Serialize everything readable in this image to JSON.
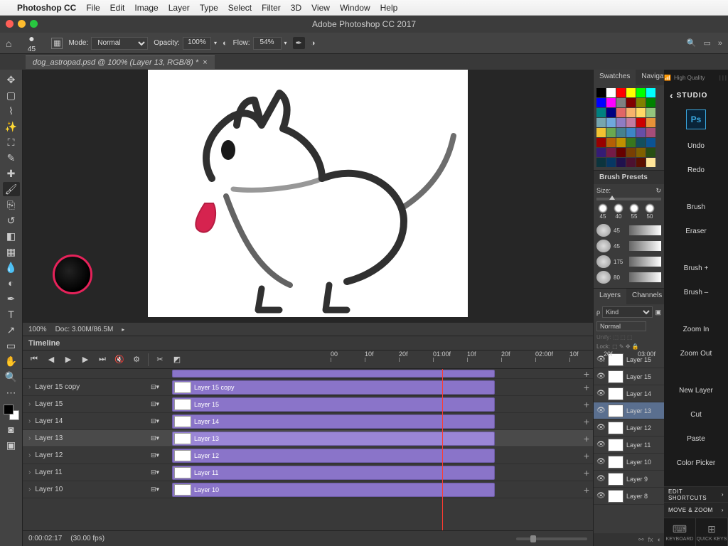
{
  "macMenu": {
    "app": "Photoshop CC",
    "items": [
      "File",
      "Edit",
      "Image",
      "Layer",
      "Type",
      "Select",
      "Filter",
      "3D",
      "View",
      "Window",
      "Help"
    ]
  },
  "windowTitle": "Adobe Photoshop CC 2017",
  "docTab": {
    "label": "dog_astropad.psd @ 100% (Layer 13, RGB/8) *"
  },
  "optionsBar": {
    "brushSize": "45",
    "modeLabel": "Mode:",
    "modeValue": "Normal",
    "opacityLabel": "Opacity:",
    "opacityValue": "100%",
    "flowLabel": "Flow:",
    "flowValue": "54%"
  },
  "status": {
    "zoom": "100%",
    "docInfo": "Doc: 3.00M/86.5M"
  },
  "timeline": {
    "title": "Timeline",
    "rulerLabels": [
      "00",
      "10f",
      "20f",
      "01:00f",
      "10f",
      "20f",
      "02:00f",
      "10f",
      "20f",
      "03:00f"
    ],
    "tracks": [
      {
        "name": "Layer 15 copy",
        "sel": false
      },
      {
        "name": "Layer 15",
        "sel": false
      },
      {
        "name": "Layer 14",
        "sel": false
      },
      {
        "name": "Layer 13",
        "sel": true
      },
      {
        "name": "Layer 12",
        "sel": false
      },
      {
        "name": "Layer 11",
        "sel": false
      },
      {
        "name": "Layer 10",
        "sel": false
      }
    ],
    "footer": {
      "time": "0:00:02:17",
      "fps": "(30.00 fps)"
    }
  },
  "swatchColors": [
    "#000",
    "#fff",
    "#ff0000",
    "#ffff00",
    "#00ff00",
    "#00ffff",
    "#0000ff",
    "#ff00ff",
    "#808080",
    "#800000",
    "#808000",
    "#008000",
    "#008080",
    "#000080",
    "#e06666",
    "#f6b26b",
    "#ffd966",
    "#93c47d",
    "#76a5af",
    "#6fa8dc",
    "#8e7cc3",
    "#c27ba0",
    "#cc0000",
    "#e69138",
    "#f1c232",
    "#6aa84f",
    "#45818e",
    "#3d85c6",
    "#674ea7",
    "#a64d79",
    "#990000",
    "#b45f06",
    "#bf9000",
    "#38761d",
    "#134f5c",
    "#0b5394",
    "#351c75",
    "#741b47",
    "#660000",
    "#783f04",
    "#7f6000",
    "#274e13",
    "#0c343d",
    "#073763",
    "#20124d",
    "#4c1130",
    "#5b0f00",
    "#ffe599"
  ],
  "brushPresets": {
    "title": "Brush Presets",
    "sizeLabel": "Size:",
    "quick": [
      "45",
      "40",
      "55",
      "50"
    ],
    "list": [
      "45",
      "45",
      "175",
      "80"
    ]
  },
  "layersPanel": {
    "tabLayers": "Layers",
    "tabChannels": "Channels",
    "kind": "Kind",
    "blend": "Normal",
    "unify": "Unify:",
    "lock": "Lock:",
    "rows": [
      {
        "name": "Layer 15",
        "sel": false
      },
      {
        "name": "Layer 15",
        "sel": false
      },
      {
        "name": "Layer 14",
        "sel": false
      },
      {
        "name": "Layer 13",
        "sel": true
      },
      {
        "name": "Layer 12",
        "sel": false
      },
      {
        "name": "Layer 11",
        "sel": false
      },
      {
        "name": "Layer 10",
        "sel": false
      },
      {
        "name": "Layer 9",
        "sel": false
      },
      {
        "name": "Layer 8",
        "sel": false
      }
    ]
  },
  "swatchesTabs": {
    "swatches": "Swatches",
    "navigator": "Navigato"
  },
  "astropad": {
    "top": "High Quality",
    "studio": "STUDIO",
    "ps": "Ps",
    "shortcuts": [
      "Undo",
      "Redo",
      "",
      "Brush",
      "Eraser",
      "",
      "Brush  +",
      "Brush  –",
      "",
      "Zoom In",
      "Zoom Out",
      "",
      "New Layer",
      "Cut",
      "Paste",
      "Color Picker"
    ],
    "editShortcuts": "EDIT SHORTCUTS",
    "moveZoom": "MOVE & ZOOM",
    "bottom": [
      "KEYBOARD",
      "QUICK KEYS"
    ]
  }
}
